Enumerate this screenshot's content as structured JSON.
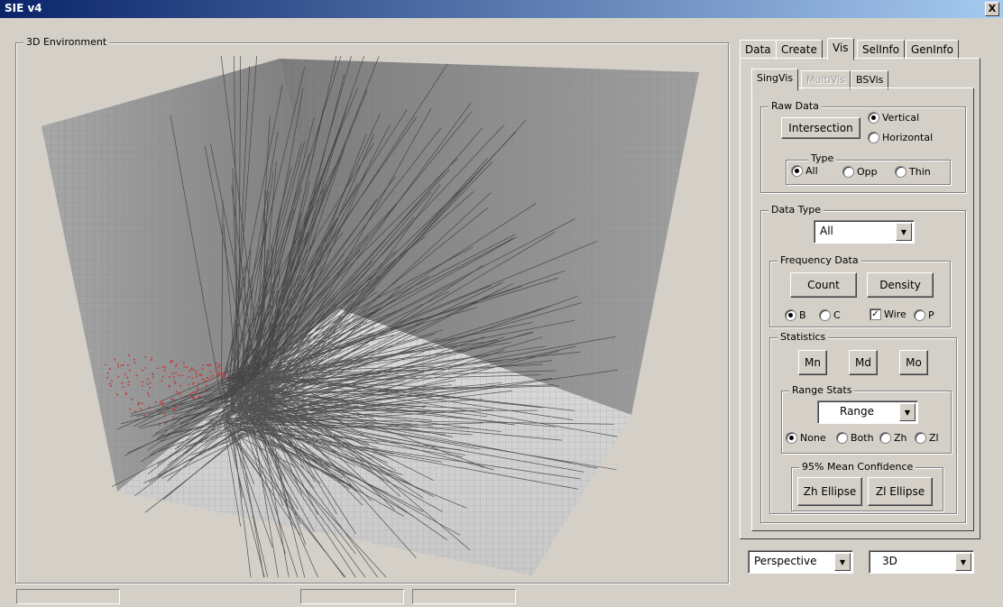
{
  "window": {
    "title": "SIE v4",
    "close_label": "X"
  },
  "env": {
    "group_label": "3D Environment"
  },
  "tabs": [
    {
      "label": "Data"
    },
    {
      "label": "Create"
    },
    {
      "label": "Vis"
    },
    {
      "label": "SelInfo"
    },
    {
      "label": "GenInfo"
    }
  ],
  "subtabs": [
    {
      "label": "SingVis"
    },
    {
      "label": "MultiVis"
    },
    {
      "label": "BSVis"
    }
  ],
  "raw_data": {
    "label": "Raw Data",
    "intersection": "Intersection",
    "vertical": "Vertical",
    "horizontal": "Horizontal",
    "type_label": "Type",
    "all": "All",
    "opp": "Opp",
    "thin": "Thin"
  },
  "data_type": {
    "label": "Data Type",
    "selected": "All",
    "frequency_label": "Frequency Data",
    "count": "Count",
    "density": "Density",
    "b": "B",
    "c": "C",
    "wire": "Wire",
    "p": "P",
    "stats_label": "Statistics",
    "mn": "Mn",
    "md": "Md",
    "mo": "Mo",
    "range_stats_label": "Range Stats",
    "range_selected": "Range",
    "none": "None",
    "both": "Both",
    "zh": "Zh",
    "zl": "Zl",
    "confidence_label": "95% Mean Confidence",
    "zh_ellipse": "Zh Ellipse",
    "zl_ellipse": "Zl Ellipse"
  },
  "bottom": {
    "projection": "Perspective",
    "mode": "3D"
  }
}
